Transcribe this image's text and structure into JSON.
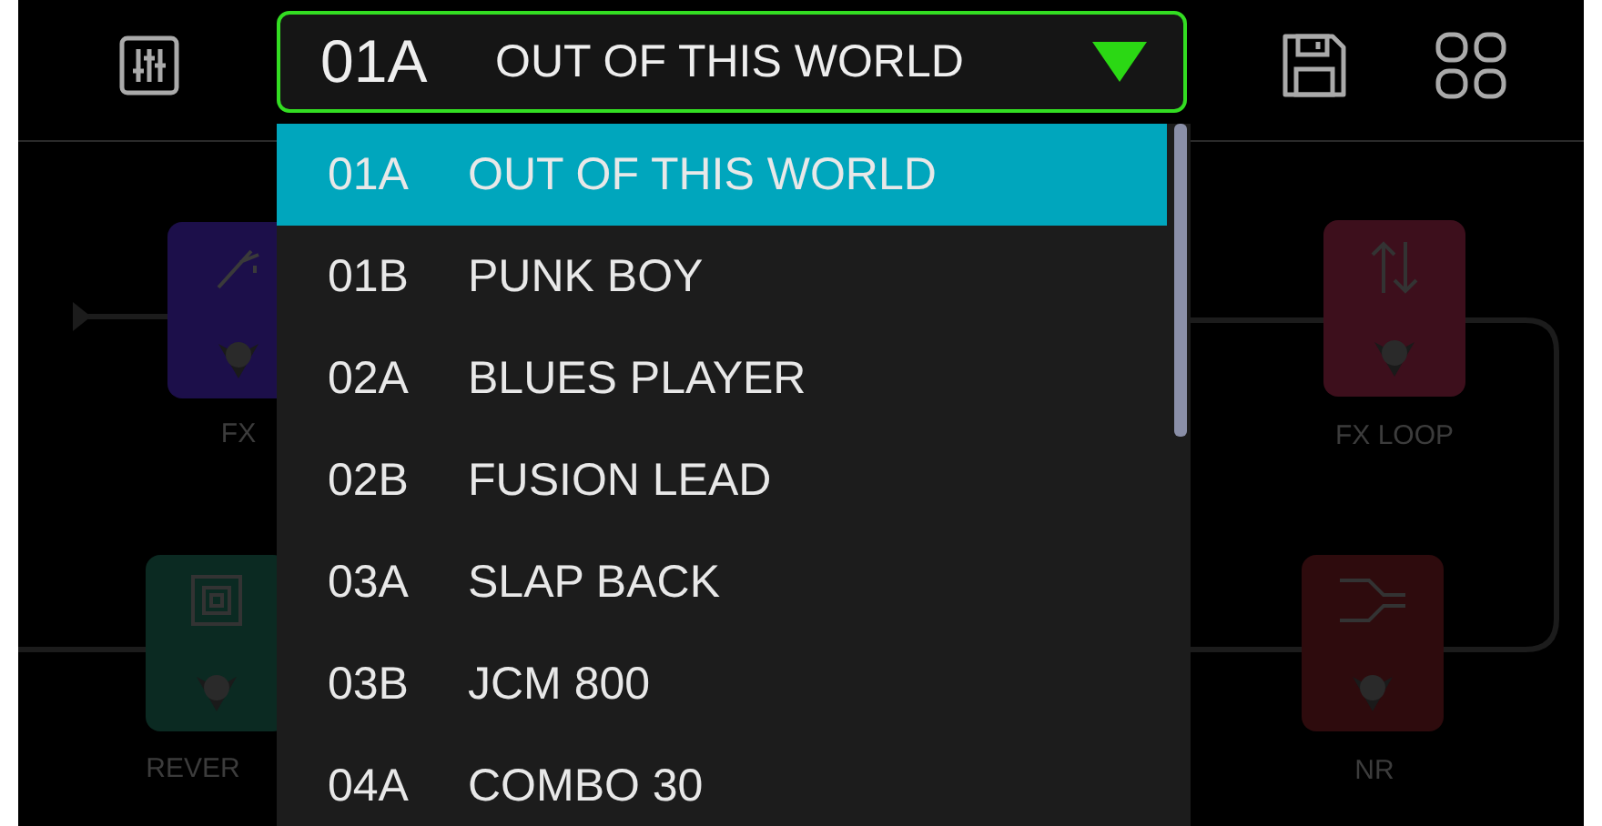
{
  "preset_selector": {
    "code": "01A",
    "name": "OUT OF THIS WORLD",
    "expanded": true
  },
  "presets": [
    {
      "code": "01A",
      "name": "OUT OF THIS WORLD",
      "selected": true
    },
    {
      "code": "01B",
      "name": "PUNK BOY",
      "selected": false
    },
    {
      "code": "02A",
      "name": "BLUES PLAYER",
      "selected": false
    },
    {
      "code": "02B",
      "name": "FUSION LEAD",
      "selected": false
    },
    {
      "code": "03A",
      "name": "SLAP BACK",
      "selected": false
    },
    {
      "code": "03B",
      "name": "JCM 800",
      "selected": false
    },
    {
      "code": "04A",
      "name": "COMBO 30",
      "selected": false
    }
  ],
  "pedals": [
    {
      "kind": "fx",
      "label": "FX",
      "color": "#1c0f4a"
    },
    {
      "kind": "reverb",
      "label": "REVER",
      "color": "#0b2a22"
    },
    {
      "kind": "loop",
      "label": "FX LOOP",
      "color": "#3d0f1c"
    },
    {
      "kind": "nr",
      "label": "NR",
      "color": "#2e0b0d"
    }
  ]
}
